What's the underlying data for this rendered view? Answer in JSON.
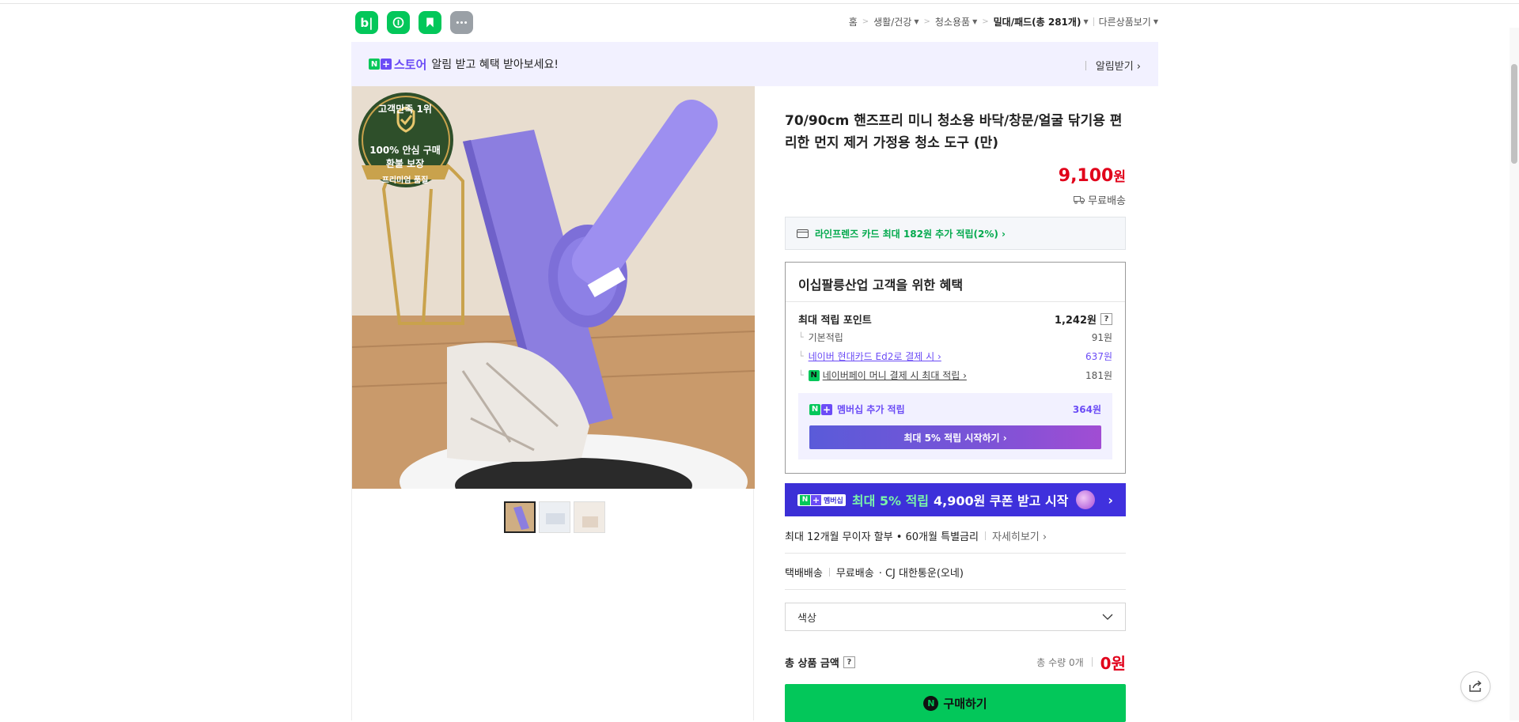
{
  "header": {
    "apps": [
      {
        "name": "blog",
        "label": "b|"
      },
      {
        "name": "cafe"
      },
      {
        "name": "bookmark"
      },
      {
        "name": "more"
      }
    ],
    "breadcrumb": [
      "홈",
      "생활/건강",
      "청소용품",
      "밀대/패드(총 281개)",
      "다른상품보기"
    ]
  },
  "alert": {
    "store": "스토어",
    "text": "알림 받고 혜택 받아보세요!",
    "action": "알림받기 ›"
  },
  "badge": {
    "top": "고객만족 1위",
    "mid1": "100% 안심 구매",
    "mid2": "환불 보장",
    "ribbon": "프리미엄 품질"
  },
  "product": {
    "title": "70/90cm 핸즈프리 미니 청소용 바닥/창문/얼굴 닦기용 편리한 먼지 제거 가정용 청소 도구 (만)",
    "price": "9,100",
    "price_unit": "원",
    "shipping": "무료배송",
    "card_offer": "라인프렌즈 카드 최대 182원 추가 적립(2%) ›"
  },
  "benefit": {
    "title": "이십팔릉산업 고객을 위한 혜택",
    "max_label": "최대 적립 포인트",
    "max_value": "1,242원",
    "rows": [
      {
        "label": "기본적립",
        "value": "91원"
      },
      {
        "label": "네이버 현대카드 Ed2로 결제 시 ›",
        "value": "637원"
      },
      {
        "label": "네이버페이 머니 결제 시 최대 적립 ›",
        "value": "181원"
      }
    ],
    "member_label": "멤버십 추가 적립",
    "member_value": "364원",
    "member_btn": "최대 5% 적립 시작하기 ›"
  },
  "coupon": {
    "badge": "멤버십",
    "text_a": "최대 5% 적립",
    "text_b": "4,900원 쿠폰 받고 시작"
  },
  "install": {
    "text": "최대 12개월 무이자 할부 • 60개월 특별금리",
    "more": "자세히보기 ›"
  },
  "delivery": {
    "type": "택배배송",
    "fee": "무료배송",
    "carrier": "· CJ 대한통운(오네)"
  },
  "option": {
    "placeholder": "색상"
  },
  "total": {
    "label": "총 상품 금액",
    "qty": "총 수량 0개",
    "amount": "0원"
  },
  "buy": {
    "label": "구매하기"
  },
  "colors": {
    "naver_green": "#03c75a",
    "price_red": "#e1001a",
    "membership_purple": "#6b4cf6"
  }
}
